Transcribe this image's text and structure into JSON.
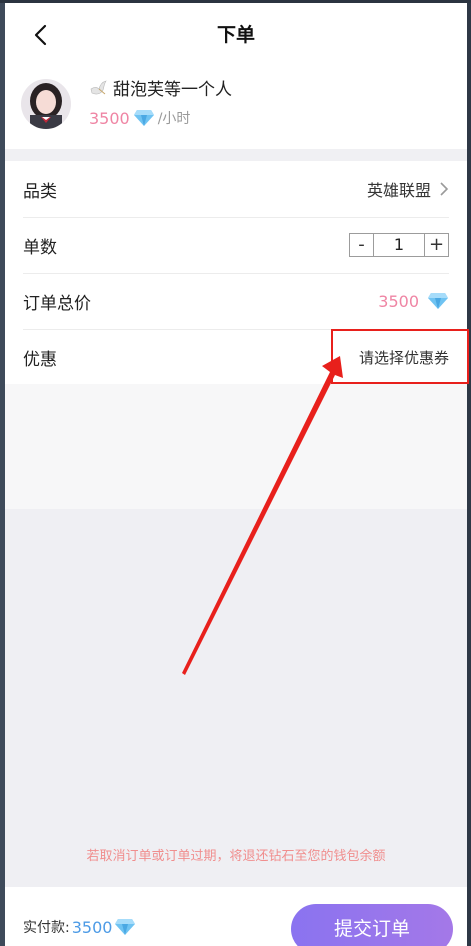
{
  "header": {
    "title": "下单"
  },
  "profile": {
    "name": "甜泡芙等一个人",
    "price": "3500",
    "unit": "/小时"
  },
  "order": {
    "category_label": "品类",
    "category_value": "英雄联盟",
    "count_label": "单数",
    "count_value": "1",
    "minus": "-",
    "plus": "+",
    "total_label": "订单总价",
    "total_value": "3500",
    "discount_label": "优惠",
    "discount_value": "请选择优惠券"
  },
  "notice": "若取消订单或订单过期，将退还钻石至您的钱包余额",
  "footer": {
    "pay_label": "实付款:",
    "pay_amount": "3500",
    "submit_label": "提交订单"
  },
  "colors": {
    "accent_pink": "#ef85a4",
    "accent_blue": "#4d9be6",
    "button_purple": "#8a73f0",
    "annotation_red": "#e8201c"
  }
}
